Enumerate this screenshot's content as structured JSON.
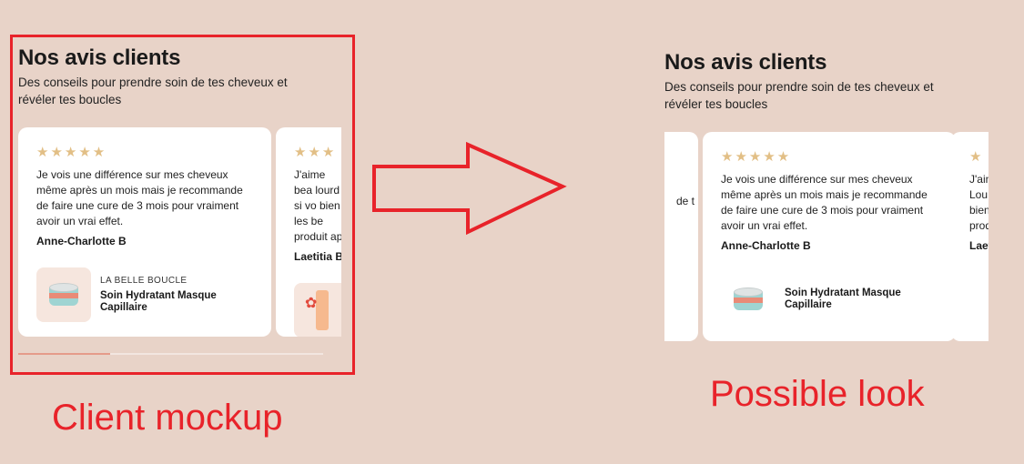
{
  "section": {
    "title": "Nos avis clients",
    "subtitle": "Des conseils pour prendre soin de tes cheveux et révéler tes boucles"
  },
  "reviews": [
    {
      "stars": "★★★★★",
      "text": "Je vois une différence sur mes cheveux même après un mois mais je recommande de faire une cure de 3 mois pour vraiment avoir un vrai effet.",
      "author": "Anne-Charlotte B",
      "brand": "LA BELLE BOUCLE",
      "product": "Soin Hydratant Masque Capillaire"
    },
    {
      "stars": "★★★",
      "text": "J'aime bea lourd si vo bien les be produit ap",
      "author": "Laetitia B"
    }
  ],
  "right_partial_left": {
    "text": "de t"
  },
  "right_partial_next": {
    "stars": "★",
    "text": "J'ain Lou bien prod",
    "author": "Laet"
  },
  "carousel": {
    "progress": 0.3
  },
  "captions": {
    "left": "Client mockup",
    "right": "Possible look"
  },
  "colors": {
    "background": "#e8d3c8",
    "annotation_red": "#e8232a",
    "star": "#e2bf86",
    "progress_fill": "#e59b8a"
  }
}
